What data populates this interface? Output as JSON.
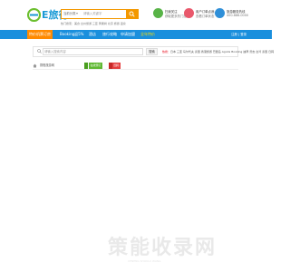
{
  "header": {
    "logo_text": "E旅行",
    "logo_sub": "www.elvxing.com",
    "search": {
      "scope": "当前分类",
      "placeholder": "请输入关键字"
    },
    "hot_links": "热门搜索：美食  台州旅游  三亚  黄果树  北京  旅游  温泉"
  },
  "badges": [
    {
      "title": "扫我关注",
      "sub": "获取更多热门旅游",
      "color": "#58b347"
    },
    {
      "title": "用户订单点我",
      "sub": "查看订单状态",
      "color": "#e9586b"
    },
    {
      "title": "旅游服务热线",
      "sub": "400-888-0000",
      "color": "#2f8fd8"
    }
  ],
  "nav": {
    "items": [
      "特价机票订房",
      "Booking返5%",
      "酒店",
      "旅行攻略",
      "申请加盟",
      "全年特价"
    ],
    "right": "注册 | 登录"
  },
  "search_row": {
    "placeholder": "请输入搜索内容",
    "button": "搜索",
    "hot_first": "热搜：",
    "hot_rest": "日本  三亚  马尔代夫  泰国  香港旅游  巴厘岛  Agoda  Booking  迪拜  普吉  台湾  泰国  日韩"
  },
  "breadcrumb": {
    "text": "携程旅游网",
    "tag_green": "在线预订",
    "tag_red": "国际"
  },
  "watermark": {
    "big": "策能收录网",
    "small": "CENENG SHOULU WANG"
  }
}
